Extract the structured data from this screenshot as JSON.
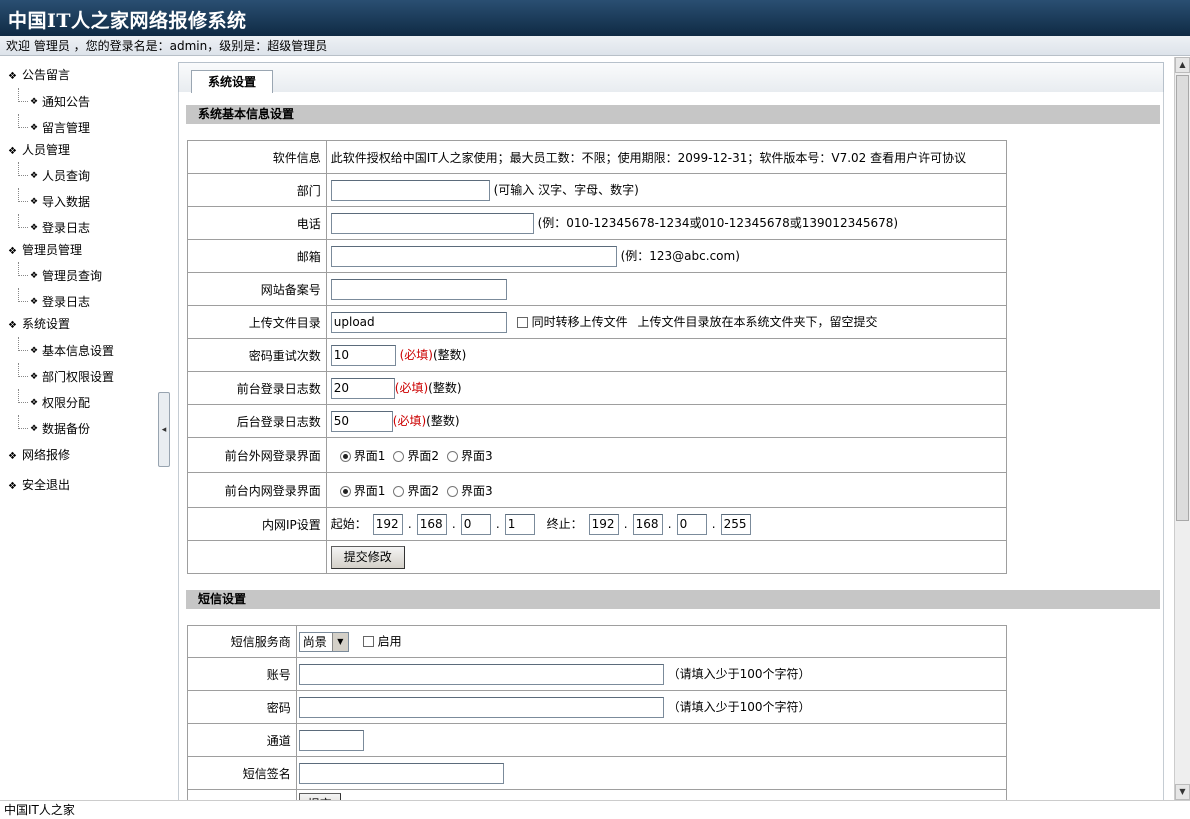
{
  "header": {
    "title": "中国IT人之家网络报修系统"
  },
  "welcome": {
    "text": "欢迎 管理员 ，您的登录名是：admin，级别是：超级管理员"
  },
  "sidebar": {
    "announcements": {
      "label": "公告留言",
      "items": [
        "通知公告",
        "留言管理"
      ]
    },
    "personnel": {
      "label": "人员管理",
      "items": [
        "人员查询",
        "导入数据",
        "登录日志"
      ]
    },
    "admins": {
      "label": "管理员管理",
      "items": [
        "管理员查询",
        "登录日志"
      ]
    },
    "system": {
      "label": "系统设置",
      "items": [
        "基本信息设置",
        "部门权限设置",
        "权限分配",
        "数据备份"
      ]
    },
    "repair": {
      "label": "网络报修"
    },
    "logout": {
      "label": "安全退出"
    },
    "toggle_glyph": "◂"
  },
  "tab": {
    "label": "系统设置"
  },
  "basic": {
    "heading": "系统基本信息设置",
    "software_label": "软件信息",
    "software_text": "此软件授权给中国IT人之家使用；最大员工数：不限；使用期限：2099-12-31；软件版本号：V7.02",
    "license_link": "查看用户许可协议",
    "dept_label": "部门",
    "dept_hint": "(可输入 汉字、字母、数字)",
    "phone_label": "电话",
    "phone_hint": "(例：010-12345678-1234或010-12345678或139012345678)",
    "email_label": "邮箱",
    "email_hint": "(例：123@abc.com)",
    "icp_label": "网站备案号",
    "upload_label": "上传文件目录",
    "upload_value": "upload",
    "upload_cb_label": "同时转移上传文件",
    "upload_note": "上传文件目录放在本系统文件夹下，留空提交",
    "pwd_retry_label": "密码重试次数",
    "pwd_retry_value": "10",
    "front_log_label": "前台登录日志数",
    "front_log_value": "20",
    "back_log_label": "后台登录日志数",
    "back_log_value": "50",
    "required": "(必填)",
    "integer": "(整数)",
    "ext_login_label": "前台外网登录界面",
    "int_login_label": "前台内网登录界面",
    "ui_options": [
      "界面1",
      "界面2",
      "界面3"
    ],
    "ip_label": "内网IP设置",
    "ip_start_label": "起始：",
    "ip_end_label": "终止：",
    "ip_start": [
      "192",
      "168",
      "0",
      "1"
    ],
    "ip_end": [
      "192",
      "168",
      "0",
      "255"
    ],
    "ip_dot": ".",
    "submit": "提交修改"
  },
  "sms": {
    "heading": "短信设置",
    "provider_label": "短信服务商",
    "provider_value": "尚景",
    "enable_label": "启用",
    "account_label": "账号",
    "account_hint": "（请填入少于100个字符）",
    "password_label": "密码",
    "password_hint": "（请填入少于100个字符）",
    "channel_label": "通道",
    "signature_label": "短信签名",
    "submit": "提交"
  },
  "footer": {
    "text": "中国IT人之家"
  }
}
